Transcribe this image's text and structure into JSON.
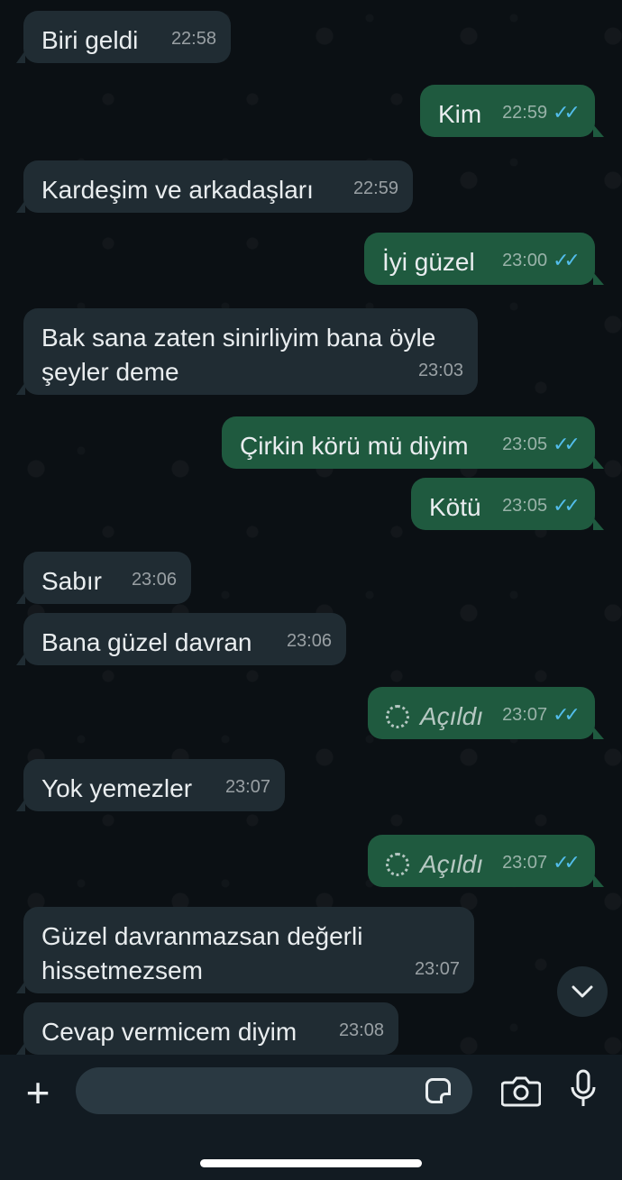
{
  "messages": [
    {
      "dir": "in",
      "text": "Biri geldi",
      "time": "22:58"
    },
    {
      "dir": "out",
      "text": "Kim",
      "time": "22:59",
      "read": true
    },
    {
      "dir": "in",
      "text": "Kardeşim ve arkadaşları",
      "time": "22:59"
    },
    {
      "dir": "out",
      "text": "İyi güzel",
      "time": "23:00",
      "read": true
    },
    {
      "dir": "in",
      "text": "Bak sana zaten sinirliyim bana öyle\nşeyler deme",
      "time": "23:03"
    },
    {
      "dir": "out",
      "text": "Çirkin körü mü diyim",
      "time": "23:05",
      "read": true
    },
    {
      "dir": "out",
      "text": "Kötü",
      "time": "23:05",
      "read": true
    },
    {
      "dir": "in",
      "text": "Sabır",
      "time": "23:06"
    },
    {
      "dir": "in",
      "text": "Bana güzel davran",
      "time": "23:06"
    },
    {
      "dir": "out",
      "text": "Açıldı",
      "time": "23:07",
      "read": true,
      "view_once": true
    },
    {
      "dir": "in",
      "text": "Yok yemezler",
      "time": "23:07"
    },
    {
      "dir": "out",
      "text": "Açıldı",
      "time": "23:07",
      "read": true,
      "view_once": true
    },
    {
      "dir": "in",
      "text": "Güzel davranmazsan değerli\nhissetmezsem",
      "time": "23:07"
    },
    {
      "dir": "in",
      "text": "Cevap vermicem diyim",
      "time": "23:08"
    }
  ],
  "composer": {
    "placeholder": "",
    "icons": [
      "plus-icon",
      "sticker-icon",
      "camera-icon",
      "microphone-icon"
    ]
  },
  "colors": {
    "incoming_bubble": "#202c33",
    "outgoing_bubble": "#1f5a3f",
    "read_ticks": "#53bdeb",
    "background": "#0b1014"
  }
}
